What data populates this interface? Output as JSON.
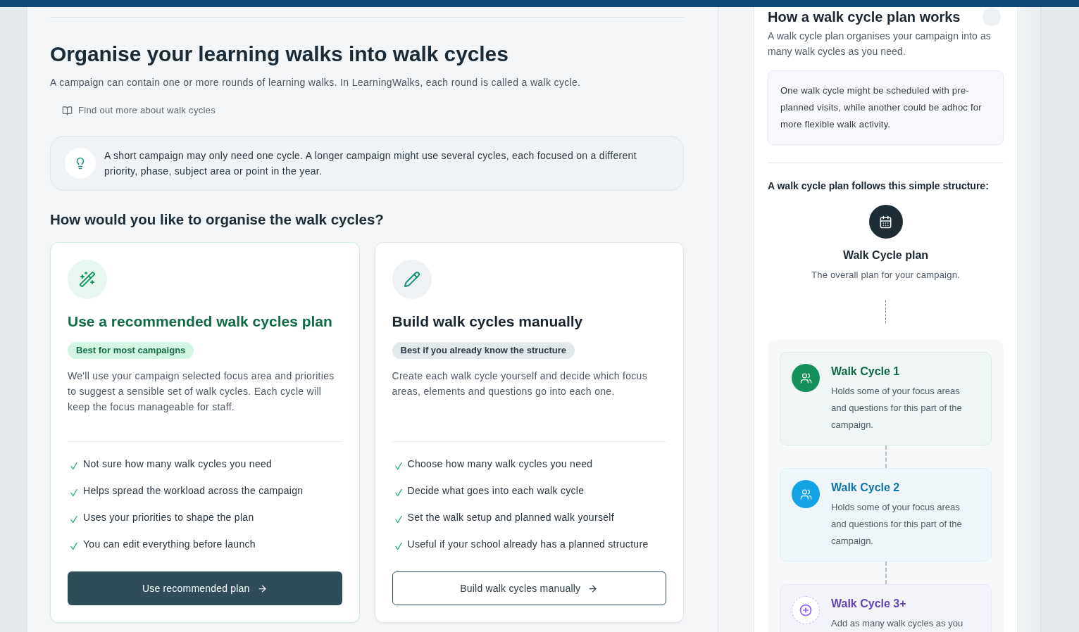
{
  "page": {
    "title": "Organise your learning walks into walk cycles",
    "subtitle": "A campaign can contain one or more rounds of learning walks. In LearningWalks, each round is called a walk cycle.",
    "help_link": "Find out more about walk cycles",
    "tip": "A short campaign may only need one cycle. A longer campaign might use several cycles, each focused on a different priority, phase, subject area or point in the year."
  },
  "question": "How would you like to organise the walk cycles?",
  "options": [
    {
      "kind": "recommended",
      "title": "Use a recommended walk cycles plan",
      "badge": "Best for most campaigns",
      "description": "We'll use your campaign selected focus area and priorities to suggest a sensible set of walk cycles. Each cycle will keep the focus manageable for staff.",
      "benefits": [
        "Not sure how many walk cycles you need",
        "Helps spread the workload across the campaign",
        "Uses your priorities to shape the plan",
        "You can edit everything before launch"
      ],
      "button": "Use recommended plan"
    },
    {
      "kind": "manual",
      "title": "Build walk cycles manually",
      "badge": "Best if you already know the structure",
      "description": "Create each walk cycle yourself and decide which focus areas, elements and questions go into each one.",
      "benefits": [
        "Choose how many walk cycles you need",
        "Decide what goes into each walk cycle",
        "Set the walk setup and planned walk yourself",
        "Useful if your school already has a planned structure"
      ],
      "button": "Build walk cycles manually"
    }
  ],
  "side_panel": {
    "title": "How a walk cycle plan works",
    "intro": "A walk cycle plan organises your campaign into as many walk cycles as you need.",
    "example": "One walk cycle might be scheduled with pre-planned visits, while another could be adhoc for more flexible walk activity.",
    "structure_heading": "A walk cycle plan follows this simple structure:",
    "plan": {
      "title": "Walk Cycle plan",
      "description": "The overall plan for your campaign."
    },
    "cycles": [
      {
        "kind": "cycle",
        "title": "Walk Cycle 1",
        "description": "Holds some of your focus areas and questions for this part of the campaign.",
        "color": "#13905b"
      },
      {
        "kind": "cycle",
        "title": "Walk Cycle 2",
        "description": "Holds some of your focus areas and questions for this part of the campaign.",
        "color": "#14a3e4"
      },
      {
        "kind": "add",
        "title": "Walk Cycle 3+",
        "description": "Add as many walk cycles as you",
        "color": "#8b5cf6"
      }
    ]
  }
}
